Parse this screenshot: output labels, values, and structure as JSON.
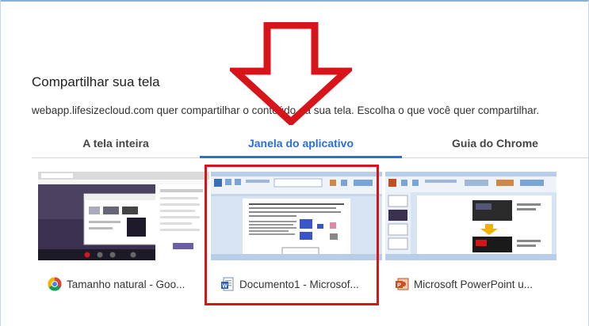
{
  "dialog": {
    "title": "Compartilhar sua tela",
    "description": "webapp.lifesizecloud.com quer compartilhar o conteúdo da sua tela. Escolha o que você quer compartilhar."
  },
  "tabs": [
    {
      "label": "A tela inteira",
      "active": false
    },
    {
      "label": "Janela do aplicativo",
      "active": true
    },
    {
      "label": "Guia do Chrome",
      "active": false
    }
  ],
  "sources": [
    {
      "label": "Tamanho natural - Goo...",
      "icon": "chrome-icon"
    },
    {
      "label": "Documento1 - Microsof...",
      "icon": "word-doc-icon",
      "highlighted": true
    },
    {
      "label": "Microsoft PowerPoint u...",
      "icon": "powerpoint-icon"
    }
  ],
  "colors": {
    "accent": "#2a6fd6",
    "annotation_red": "#d8141b"
  }
}
